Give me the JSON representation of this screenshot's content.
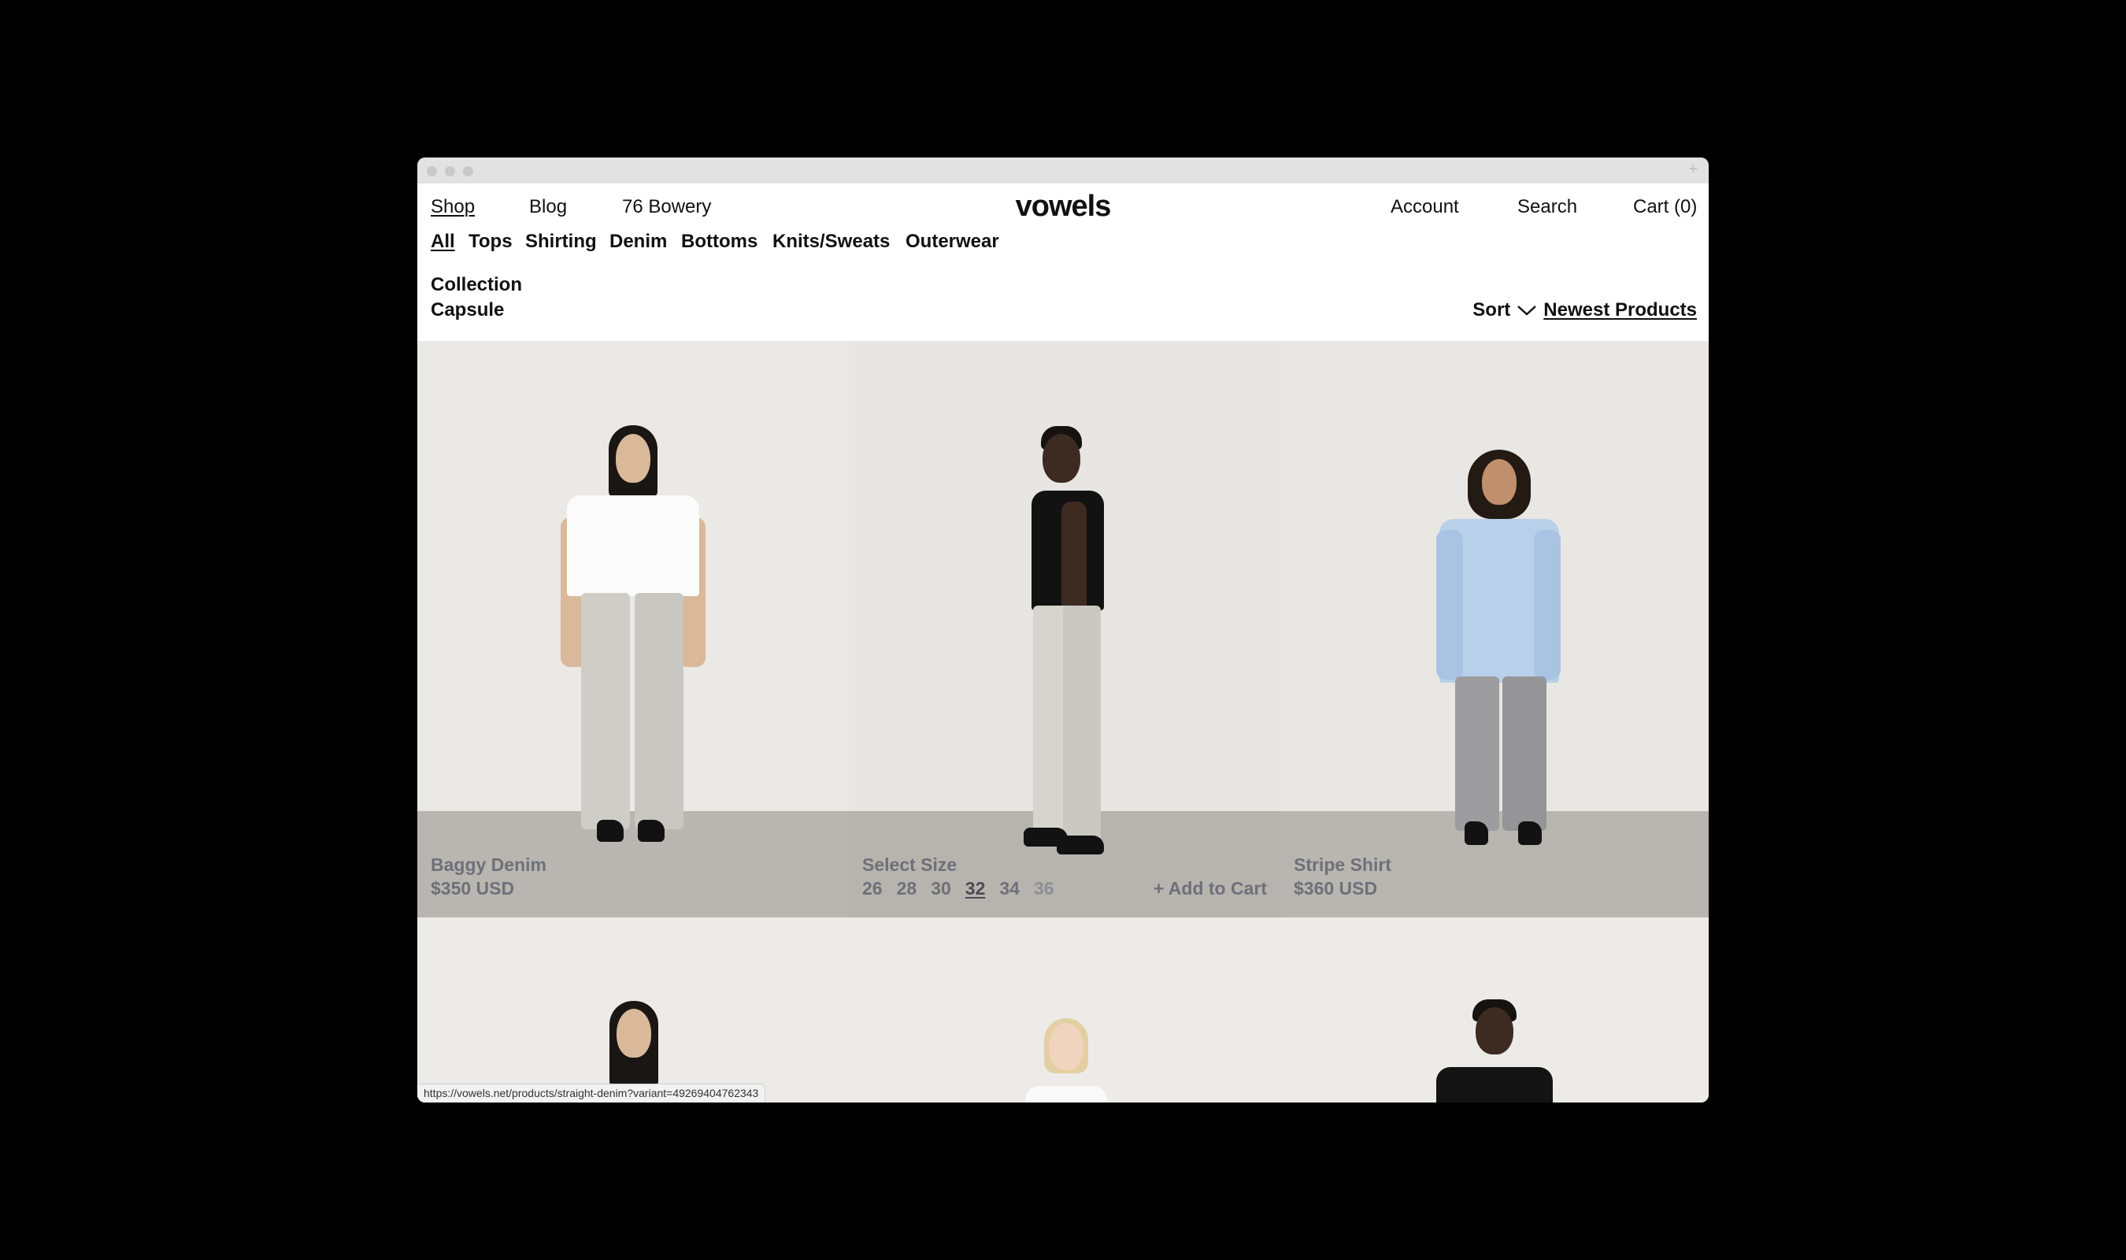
{
  "header": {
    "nav_left": [
      "Shop",
      "Blog",
      "76 Bowery"
    ],
    "logo": "vowels",
    "nav_right": [
      "Account",
      "Search",
      "Cart (0)"
    ]
  },
  "categories": [
    "All",
    "Tops",
    "Shirting",
    "Denim",
    "Bottoms",
    "Knits/Sweats",
    "Outerwear"
  ],
  "collection": {
    "label": "Collection",
    "value": "Capsule"
  },
  "sort": {
    "label": "Sort",
    "value": "Newest Products",
    "icon": "chevron-down-icon"
  },
  "products": [
    {
      "name": "Baggy Denim",
      "price": "$350 USD"
    },
    {
      "select_label": "Select Size",
      "sizes": [
        "26",
        "28",
        "30",
        "32",
        "34",
        "36"
      ],
      "selected_size": "32",
      "add_label": "+ Add to Cart"
    },
    {
      "name": "Stripe Shirt",
      "price": "$360 USD"
    }
  ],
  "status_url": "https://vowels.net/products/straight-denim?variant=49269404762343",
  "colors": {
    "background": "#000000",
    "wall": "#e9e7e4",
    "floor": "#b8b5b0",
    "caption": "#6e7078"
  }
}
